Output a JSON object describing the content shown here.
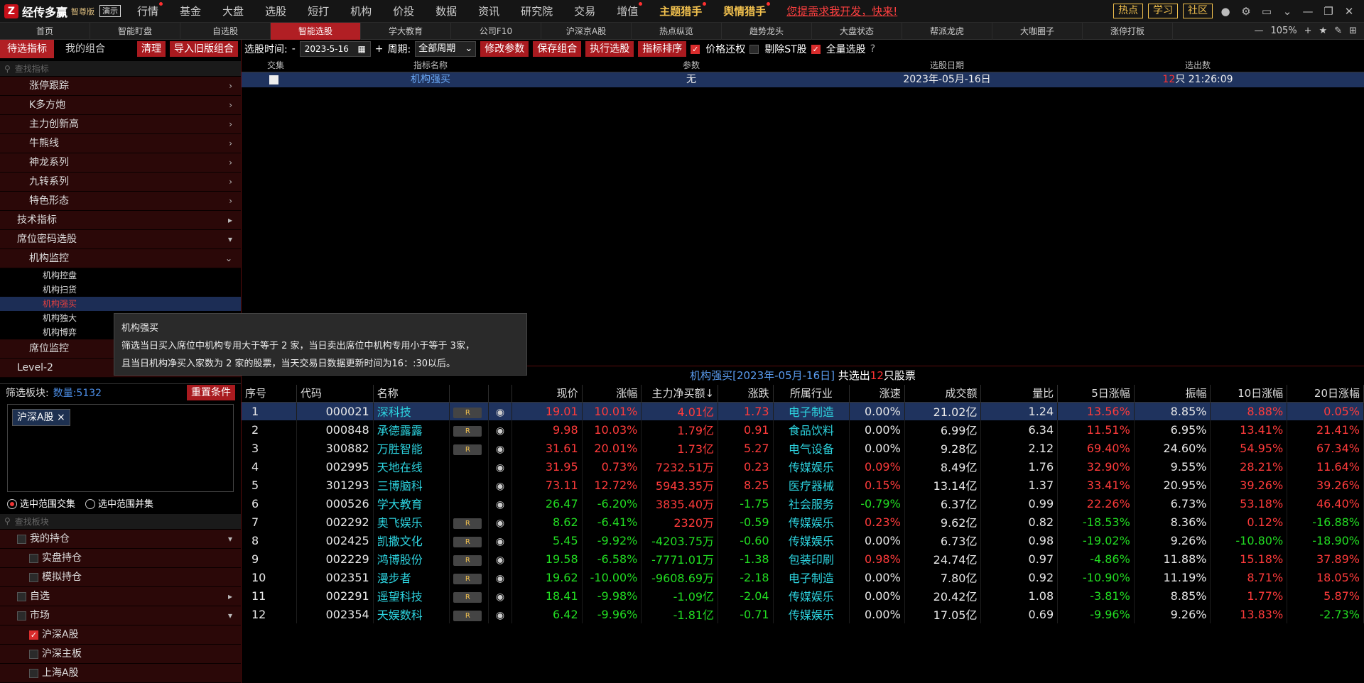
{
  "app": {
    "logo_mark": "Z",
    "name": "经传多赢",
    "edition": "智尊版",
    "demo": "演示"
  },
  "menu": [
    {
      "label": "行情",
      "dot": true
    },
    {
      "label": "基金"
    },
    {
      "label": "大盘"
    },
    {
      "label": "选股"
    },
    {
      "label": "短打"
    },
    {
      "label": "机构"
    },
    {
      "label": "价投"
    },
    {
      "label": "数据"
    },
    {
      "label": "资讯"
    },
    {
      "label": "研究院"
    },
    {
      "label": "交易"
    },
    {
      "label": "增值",
      "dot": true
    },
    {
      "label": "主题猎手",
      "dot": true,
      "gold": true
    },
    {
      "label": "舆情猎手",
      "dot": true,
      "gold": true
    }
  ],
  "promo": "您提需求我开发，快来!",
  "top_buttons": [
    "热点",
    "学习",
    "社区"
  ],
  "tabs": [
    "首页",
    "智能盯盘",
    "自选股",
    "智能选股",
    "学大教育",
    "公司F10",
    "沪深京A股",
    "热点纵览",
    "趋势龙头",
    "大盘状态",
    "帮派龙虎",
    "大咖圈子",
    "涨停打板"
  ],
  "active_tab": 3,
  "zoom": "105%",
  "left": {
    "tab1": "待选指标",
    "tab2": "我的组合",
    "clear": "清理",
    "import": "导入旧版组合",
    "search_placeholder": "查找指标",
    "tree": [
      {
        "label": "涨停跟踪",
        "level": "l2",
        "arr": "›"
      },
      {
        "label": "K多方炮",
        "level": "l2",
        "arr": "›"
      },
      {
        "label": "主力创新高",
        "level": "l2",
        "arr": "›"
      },
      {
        "label": "牛熊线",
        "level": "l2",
        "arr": "›"
      },
      {
        "label": "神龙系列",
        "level": "l2",
        "arr": "›"
      },
      {
        "label": "九转系列",
        "level": "l2",
        "arr": "›"
      },
      {
        "label": "特色形态",
        "level": "l2",
        "arr": "›"
      },
      {
        "label": "技术指标",
        "level": "l1",
        "arr": "▸"
      },
      {
        "label": "席位密码选股",
        "level": "l1",
        "arr": "▾"
      },
      {
        "label": "机构监控",
        "level": "l2",
        "arr": "⌄"
      },
      {
        "label": "机构控盘",
        "level": "l3"
      },
      {
        "label": "机构扫货",
        "level": "l3"
      },
      {
        "label": "机构强买",
        "level": "l3",
        "sel": true
      },
      {
        "label": "机构独大",
        "level": "l3"
      },
      {
        "label": "机构博弈",
        "level": "l3"
      },
      {
        "label": "席位监控",
        "level": "l2"
      },
      {
        "label": "Level-2",
        "level": "l1"
      }
    ],
    "filter_label": "筛选板块:",
    "filter_count": "数量:5132",
    "reset": "重置条件",
    "chip": "沪深A股",
    "radio1": "选中范围交集",
    "radio2": "选中范围并集",
    "search2_placeholder": "查找板块",
    "tree2": [
      {
        "label": "我的持仓",
        "level": "l1",
        "arr": "▾",
        "cb": false
      },
      {
        "label": "实盘持仓",
        "level": "l2",
        "cb": false
      },
      {
        "label": "模拟持仓",
        "level": "l2",
        "cb": false
      },
      {
        "label": "自选",
        "level": "l1",
        "arr": "▸",
        "cb": false
      },
      {
        "label": "市场",
        "level": "l1",
        "arr": "▾",
        "cb": false
      },
      {
        "label": "沪深A股",
        "level": "l2",
        "cb": true
      },
      {
        "label": "沪深主板",
        "level": "l2",
        "cb": false
      },
      {
        "label": "上海A股",
        "level": "l2",
        "cb": false
      }
    ]
  },
  "toolbar": {
    "time_label": "选股时间:",
    "dash": "-",
    "date": "2023-5-16",
    "plus": "+",
    "period_label": "周期:",
    "period": "全部周期",
    "modify": "修改参数",
    "save": "保存组合",
    "run": "执行选股",
    "sort": "指标排序",
    "price_adjust": "价格还权",
    "remove_st": "剔除ST股",
    "full_select": "全量选股"
  },
  "upper": {
    "headers": [
      "交集",
      "指标名称",
      "参数",
      "选股日期",
      "选出数"
    ],
    "row": {
      "name": "机构强买",
      "param": "无",
      "date": "2023年-05月-16日",
      "count": "12",
      "count_suffix": "只 21:26:09"
    }
  },
  "tooltip": {
    "title": "机构强买",
    "line1": "筛选当日买入席位中机构专用大于等于 2 家，当日卖出席位中机构专用小于等于 3家，",
    "line2": "且当日机构净买入家数为 2 家的股票，当天交易日数据更新时间为16：:30以后。"
  },
  "result": {
    "title": "机构强买[2023年-05月-16日]",
    "mid": " 共选出",
    "count": "12",
    "suffix": "只股票"
  },
  "columns": [
    "序号",
    "代码",
    "名称",
    "",
    "",
    "现价",
    "涨幅",
    "主力净买额↓",
    "涨跌",
    "所属行业",
    "涨速",
    "成交额",
    "量比",
    "5日涨幅",
    "振幅",
    "10日涨幅",
    "20日涨幅"
  ],
  "rows": [
    {
      "no": "1",
      "code": "000021",
      "name": "深科技",
      "r": true,
      "price": "19.01",
      "chg": "10.01%",
      "net": "4.01亿",
      "diff": "1.73",
      "ind": "电子制造",
      "speed": "0.00%",
      "amt": "21.02亿",
      "vr": "1.24",
      "d5": "13.56%",
      "amp": "8.85%",
      "d10": "8.88%",
      "d20": "0.05%",
      "s": "up",
      "sd": "wh",
      "s5": "up",
      "s10": "up",
      "s20": "up",
      "sn": "up"
    },
    {
      "no": "2",
      "code": "000848",
      "name": "承德露露",
      "r": true,
      "price": "9.98",
      "chg": "10.03%",
      "net": "1.79亿",
      "diff": "0.91",
      "ind": "食品饮料",
      "speed": "0.00%",
      "amt": "6.99亿",
      "vr": "6.34",
      "d5": "11.51%",
      "amp": "6.95%",
      "d10": "13.41%",
      "d20": "21.41%",
      "s": "up",
      "sd": "wh",
      "s5": "up",
      "s10": "up",
      "s20": "up",
      "sn": "up"
    },
    {
      "no": "3",
      "code": "300882",
      "name": "万胜智能",
      "r": true,
      "price": "31.61",
      "chg": "20.01%",
      "net": "1.73亿",
      "diff": "5.27",
      "ind": "电气设备",
      "speed": "0.00%",
      "amt": "9.28亿",
      "vr": "2.12",
      "d5": "69.40%",
      "amp": "24.60%",
      "d10": "54.95%",
      "d20": "67.34%",
      "s": "up",
      "sd": "wh",
      "s5": "up",
      "s10": "up",
      "s20": "up",
      "sn": "up"
    },
    {
      "no": "4",
      "code": "002995",
      "name": "天地在线",
      "r": false,
      "price": "31.95",
      "chg": "0.73%",
      "net": "7232.51万",
      "diff": "0.23",
      "ind": "传媒娱乐",
      "speed": "0.09%",
      "amt": "8.49亿",
      "vr": "1.76",
      "d5": "32.90%",
      "amp": "9.55%",
      "d10": "28.21%",
      "d20": "11.64%",
      "s": "up",
      "sd": "up",
      "s5": "up",
      "s10": "up",
      "s20": "up",
      "sn": "up"
    },
    {
      "no": "5",
      "code": "301293",
      "name": "三博脑科",
      "r": false,
      "price": "73.11",
      "chg": "12.72%",
      "net": "5943.35万",
      "diff": "8.25",
      "ind": "医疗器械",
      "speed": "0.15%",
      "amt": "13.14亿",
      "vr": "1.37",
      "d5": "33.41%",
      "amp": "20.95%",
      "d10": "39.26%",
      "d20": "39.26%",
      "s": "up",
      "sd": "up",
      "s5": "up",
      "s10": "up",
      "s20": "up",
      "sn": "up"
    },
    {
      "no": "6",
      "code": "000526",
      "name": "学大教育",
      "r": false,
      "price": "26.47",
      "chg": "-6.20%",
      "net": "3835.40万",
      "diff": "-1.75",
      "ind": "社会服务",
      "speed": "-0.79%",
      "amt": "6.37亿",
      "vr": "0.99",
      "d5": "22.26%",
      "amp": "6.73%",
      "d10": "53.18%",
      "d20": "46.40%",
      "s": "dn",
      "sd": "dn",
      "s5": "up",
      "s10": "up",
      "s20": "up",
      "sn": "up"
    },
    {
      "no": "7",
      "code": "002292",
      "name": "奥飞娱乐",
      "r": true,
      "price": "8.62",
      "chg": "-6.41%",
      "net": "2320万",
      "diff": "-0.59",
      "ind": "传媒娱乐",
      "speed": "0.23%",
      "amt": "9.62亿",
      "vr": "0.82",
      "d5": "-18.53%",
      "amp": "8.36%",
      "d10": "0.12%",
      "d20": "-16.88%",
      "s": "dn",
      "sd": "up",
      "s5": "dn",
      "s10": "up",
      "s20": "dn",
      "sn": "up"
    },
    {
      "no": "8",
      "code": "002425",
      "name": "凯撒文化",
      "r": true,
      "price": "5.45",
      "chg": "-9.92%",
      "net": "-4203.75万",
      "diff": "-0.60",
      "ind": "传媒娱乐",
      "speed": "0.00%",
      "amt": "6.73亿",
      "vr": "0.98",
      "d5": "-19.02%",
      "amp": "9.26%",
      "d10": "-10.80%",
      "d20": "-18.90%",
      "s": "dn",
      "sd": "wh",
      "s5": "dn",
      "s10": "dn",
      "s20": "dn",
      "sn": "dn"
    },
    {
      "no": "9",
      "code": "002229",
      "name": "鸿博股份",
      "r": true,
      "price": "19.58",
      "chg": "-6.58%",
      "net": "-7771.01万",
      "diff": "-1.38",
      "ind": "包装印刷",
      "speed": "0.98%",
      "amt": "24.74亿",
      "vr": "0.97",
      "d5": "-4.86%",
      "amp": "11.88%",
      "d10": "15.18%",
      "d20": "37.89%",
      "s": "dn",
      "sd": "up",
      "s5": "dn",
      "s10": "up",
      "s20": "up",
      "sn": "dn"
    },
    {
      "no": "10",
      "code": "002351",
      "name": "漫步者",
      "r": true,
      "price": "19.62",
      "chg": "-10.00%",
      "net": "-9608.69万",
      "diff": "-2.18",
      "ind": "电子制造",
      "speed": "0.00%",
      "amt": "7.80亿",
      "vr": "0.92",
      "d5": "-10.90%",
      "amp": "11.19%",
      "d10": "8.71%",
      "d20": "18.05%",
      "s": "dn",
      "sd": "wh",
      "s5": "dn",
      "s10": "up",
      "s20": "up",
      "sn": "dn"
    },
    {
      "no": "11",
      "code": "002291",
      "name": "遥望科技",
      "r": true,
      "price": "18.41",
      "chg": "-9.98%",
      "net": "-1.09亿",
      "diff": "-2.04",
      "ind": "传媒娱乐",
      "speed": "0.00%",
      "amt": "20.42亿",
      "vr": "1.08",
      "d5": "-3.81%",
      "amp": "8.85%",
      "d10": "1.77%",
      "d20": "5.87%",
      "s": "dn",
      "sd": "wh",
      "s5": "dn",
      "s10": "up",
      "s20": "up",
      "sn": "dn"
    },
    {
      "no": "12",
      "code": "002354",
      "name": "天娱数科",
      "r": true,
      "price": "6.42",
      "chg": "-9.96%",
      "net": "-1.81亿",
      "diff": "-0.71",
      "ind": "传媒娱乐",
      "speed": "0.00%",
      "amt": "17.05亿",
      "vr": "0.69",
      "d5": "-9.96%",
      "amp": "9.26%",
      "d10": "13.83%",
      "d20": "-2.73%",
      "s": "dn",
      "sd": "wh",
      "s5": "dn",
      "s10": "up",
      "s20": "dn",
      "sn": "dn"
    }
  ]
}
